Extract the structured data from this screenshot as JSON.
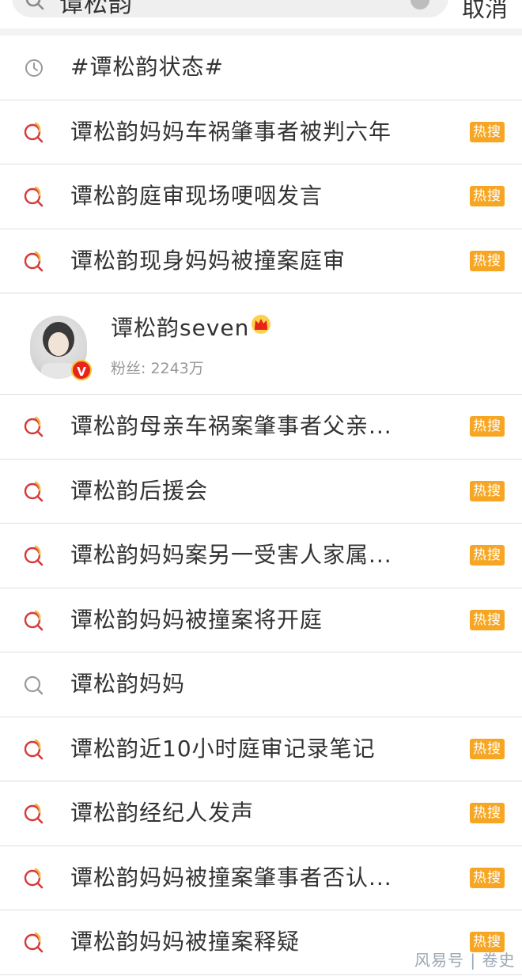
{
  "search": {
    "query": "谭松韵",
    "cancel_label": "取消"
  },
  "history_item": {
    "label": "#谭松韵状态#",
    "icon": "clock-icon"
  },
  "suggestions_top": [
    {
      "label": "谭松韵妈妈车祸肇事者被判六年",
      "badge": "热搜",
      "hot": true
    },
    {
      "label": "谭松韵庭审现场哽咽发言",
      "badge": "热搜",
      "hot": true
    },
    {
      "label": "谭松韵现身妈妈被撞案庭审",
      "badge": "热搜",
      "hot": true
    }
  ],
  "user_card": {
    "name": "谭松韵seven",
    "fans": "粉丝: 2243万",
    "verified": "V"
  },
  "suggestions_bottom": [
    {
      "label": "谭松韵母亲车祸案肇事者父亲...",
      "badge": "热搜",
      "hot": true
    },
    {
      "label": "谭松韵后援会",
      "badge": "热搜",
      "hot": true
    },
    {
      "label": "谭松韵妈妈案另一受害人家属...",
      "badge": "热搜",
      "hot": true
    },
    {
      "label": "谭松韵妈妈被撞案将开庭",
      "badge": "热搜",
      "hot": true
    },
    {
      "label": "谭松韵妈妈",
      "badge": "",
      "hot": false
    },
    {
      "label": "谭松韵近10小时庭审记录笔记",
      "badge": "热搜",
      "hot": true
    },
    {
      "label": "谭松韵经纪人发声",
      "badge": "热搜",
      "hot": true
    },
    {
      "label": "谭松韵妈妈被撞案肇事者否认...",
      "badge": "热搜",
      "hot": true
    },
    {
      "label": "谭松韵妈妈被撞案释疑",
      "badge": "热搜",
      "hot": true
    }
  ],
  "watermark": "风易号 | 卷史",
  "colors": {
    "hot_badge": "#f6a623",
    "hot_icon_red": "#d43a3a",
    "hot_icon_yellow": "#f2b43a",
    "verified_red": "#e8231b"
  }
}
